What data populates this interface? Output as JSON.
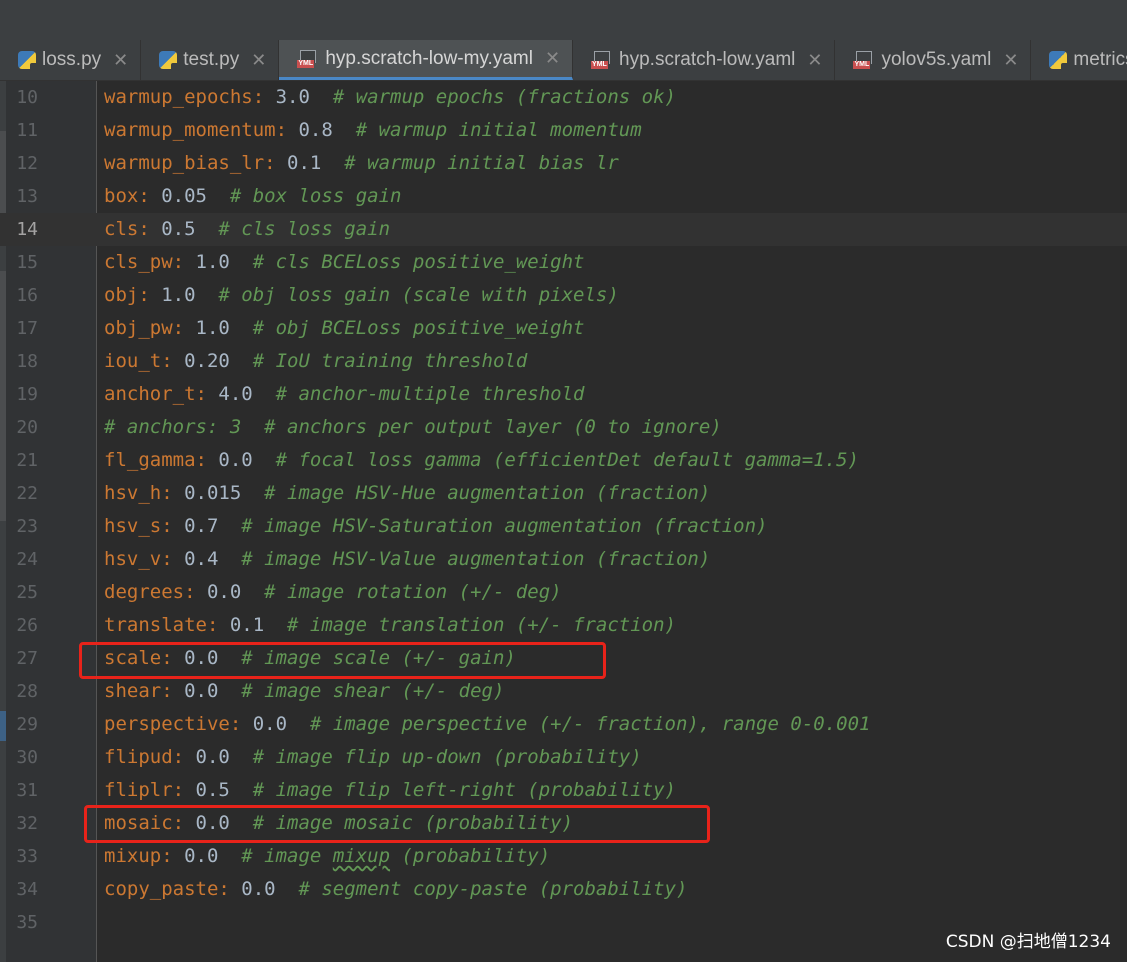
{
  "tabs": [
    {
      "label": "loss.py",
      "icon": "python-file-icon",
      "active": false,
      "close": "✕"
    },
    {
      "label": "test.py",
      "icon": "python-file-icon",
      "active": false,
      "close": "✕"
    },
    {
      "label": "hyp.scratch-low-my.yaml",
      "icon": "yaml-file-icon",
      "active": true,
      "close": "✕"
    },
    {
      "label": "hyp.scratch-low.yaml",
      "icon": "yaml-file-icon",
      "active": false,
      "close": "✕"
    },
    {
      "label": "yolov5s.yaml",
      "icon": "yaml-file-icon",
      "active": false,
      "close": "✕"
    },
    {
      "label": "metrics.p",
      "icon": "python-file-icon",
      "active": false,
      "close": ""
    }
  ],
  "yaml_icon_label": "YML",
  "current_line": "14",
  "lines": [
    {
      "num": "10",
      "key": "warmup_epochs",
      "value": " 3.0",
      "comment": "  # warmup epochs (fractions ok)"
    },
    {
      "num": "11",
      "key": "warmup_momentum",
      "value": " 0.8",
      "comment": "  # warmup initial momentum"
    },
    {
      "num": "12",
      "key": "warmup_bias_lr",
      "value": " 0.1",
      "comment": "  # warmup initial bias lr"
    },
    {
      "num": "13",
      "key": "box",
      "value": " 0.05",
      "comment": "  # box loss gain"
    },
    {
      "num": "14",
      "key": "cls",
      "value": " 0.5",
      "comment": "  # cls loss gain"
    },
    {
      "num": "15",
      "key": "cls_pw",
      "value": " 1.0",
      "comment": "  # cls BCELoss positive_weight"
    },
    {
      "num": "16",
      "key": "obj",
      "value": " 1.0",
      "comment": "  # obj loss gain (scale with pixels)"
    },
    {
      "num": "17",
      "key": "obj_pw",
      "value": " 1.0",
      "comment": "  # obj BCELoss positive_weight"
    },
    {
      "num": "18",
      "key": "iou_t",
      "value": " 0.20",
      "comment": "  # IoU training threshold"
    },
    {
      "num": "19",
      "key": "anchor_t",
      "value": " 4.0",
      "comment": "  # anchor-multiple threshold"
    },
    {
      "num": "20",
      "key": "",
      "value": "",
      "comment": "# anchors: 3  # anchors per output layer (0 to ignore)"
    },
    {
      "num": "21",
      "key": "fl_gamma",
      "value": " 0.0",
      "comment": "  # focal loss gamma (efficientDet default gamma=1.5)"
    },
    {
      "num": "22",
      "key": "hsv_h",
      "value": " 0.015",
      "comment": "  # image HSV-Hue augmentation (fraction)"
    },
    {
      "num": "23",
      "key": "hsv_s",
      "value": " 0.7",
      "comment": "  # image HSV-Saturation augmentation (fraction)"
    },
    {
      "num": "24",
      "key": "hsv_v",
      "value": " 0.4",
      "comment": "  # image HSV-Value augmentation (fraction)"
    },
    {
      "num": "25",
      "key": "degrees",
      "value": " 0.0",
      "comment": "  # image rotation (+/- deg)"
    },
    {
      "num": "26",
      "key": "translate",
      "value": " 0.1",
      "comment": "  # image translation (+/- fraction)"
    },
    {
      "num": "27",
      "key": "scale",
      "value": " 0.0",
      "comment": "  # image scale (+/- gain)"
    },
    {
      "num": "28",
      "key": "shear",
      "value": " 0.0",
      "comment": "  # image shear (+/- deg)"
    },
    {
      "num": "29",
      "key": "perspective",
      "value": " 0.0",
      "comment": "  # image perspective (+/- fraction), range 0-0.001"
    },
    {
      "num": "30",
      "key": "flipud",
      "value": " 0.0",
      "comment": "  # image flip up-down (probability)"
    },
    {
      "num": "31",
      "key": "fliplr",
      "value": " 0.5",
      "comment": "  # image flip left-right (probability)"
    },
    {
      "num": "32",
      "key": "mosaic",
      "value": " 0.0",
      "comment": "  # image mosaic (probability)"
    },
    {
      "num": "33",
      "key": "mixup",
      "value": " 0.0",
      "comment": "  # image mixup (probability)"
    },
    {
      "num": "34",
      "key": "copy_paste",
      "value": " 0.0",
      "comment": "  # segment copy-paste (probability)"
    },
    {
      "num": "35",
      "key": "",
      "value": "",
      "comment": ""
    }
  ],
  "highlighted_lines": [
    "27",
    "32"
  ],
  "colors": {
    "key": "#cc7832",
    "comment": "#629755",
    "value": "#a9b7c6",
    "highlight": "#e8231a"
  },
  "watermark": "CSDN @扫地僧1234"
}
